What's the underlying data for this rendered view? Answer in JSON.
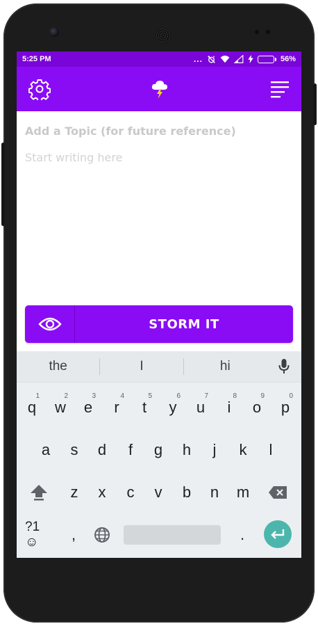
{
  "statusbar": {
    "time": "5:25 PM",
    "dots": "...",
    "battery_percent": "56%",
    "battery_level": 0.56
  },
  "appbar": {
    "settings_icon": "gear-icon",
    "logo_icon": "storm-cloud-icon",
    "menu_icon": "menu-lines-icon"
  },
  "editor": {
    "topic_placeholder": "Add a Topic (for future reference)",
    "body_placeholder": "Start writing here"
  },
  "action": {
    "preview_icon": "eye-icon",
    "storm_label": "STORM IT"
  },
  "keyboard": {
    "suggestions": [
      "the",
      "I",
      "hi"
    ],
    "row1": [
      {
        "key": "q",
        "hint": "1"
      },
      {
        "key": "w",
        "hint": "2"
      },
      {
        "key": "e",
        "hint": "3"
      },
      {
        "key": "r",
        "hint": "4"
      },
      {
        "key": "t",
        "hint": "5"
      },
      {
        "key": "y",
        "hint": "6"
      },
      {
        "key": "u",
        "hint": "7"
      },
      {
        "key": "i",
        "hint": "8"
      },
      {
        "key": "o",
        "hint": "9"
      },
      {
        "key": "p",
        "hint": "0"
      }
    ],
    "row2": [
      "a",
      "s",
      "d",
      "f",
      "g",
      "h",
      "j",
      "k",
      "l"
    ],
    "row3": [
      "z",
      "x",
      "c",
      "v",
      "b",
      "n",
      "m"
    ],
    "symbols_label": "?1☺",
    "comma": ",",
    "period": "."
  },
  "colors": {
    "status_bar": "#7a05d8",
    "app_bar": "#8a0cf5",
    "enter_key": "#4db6ac"
  }
}
